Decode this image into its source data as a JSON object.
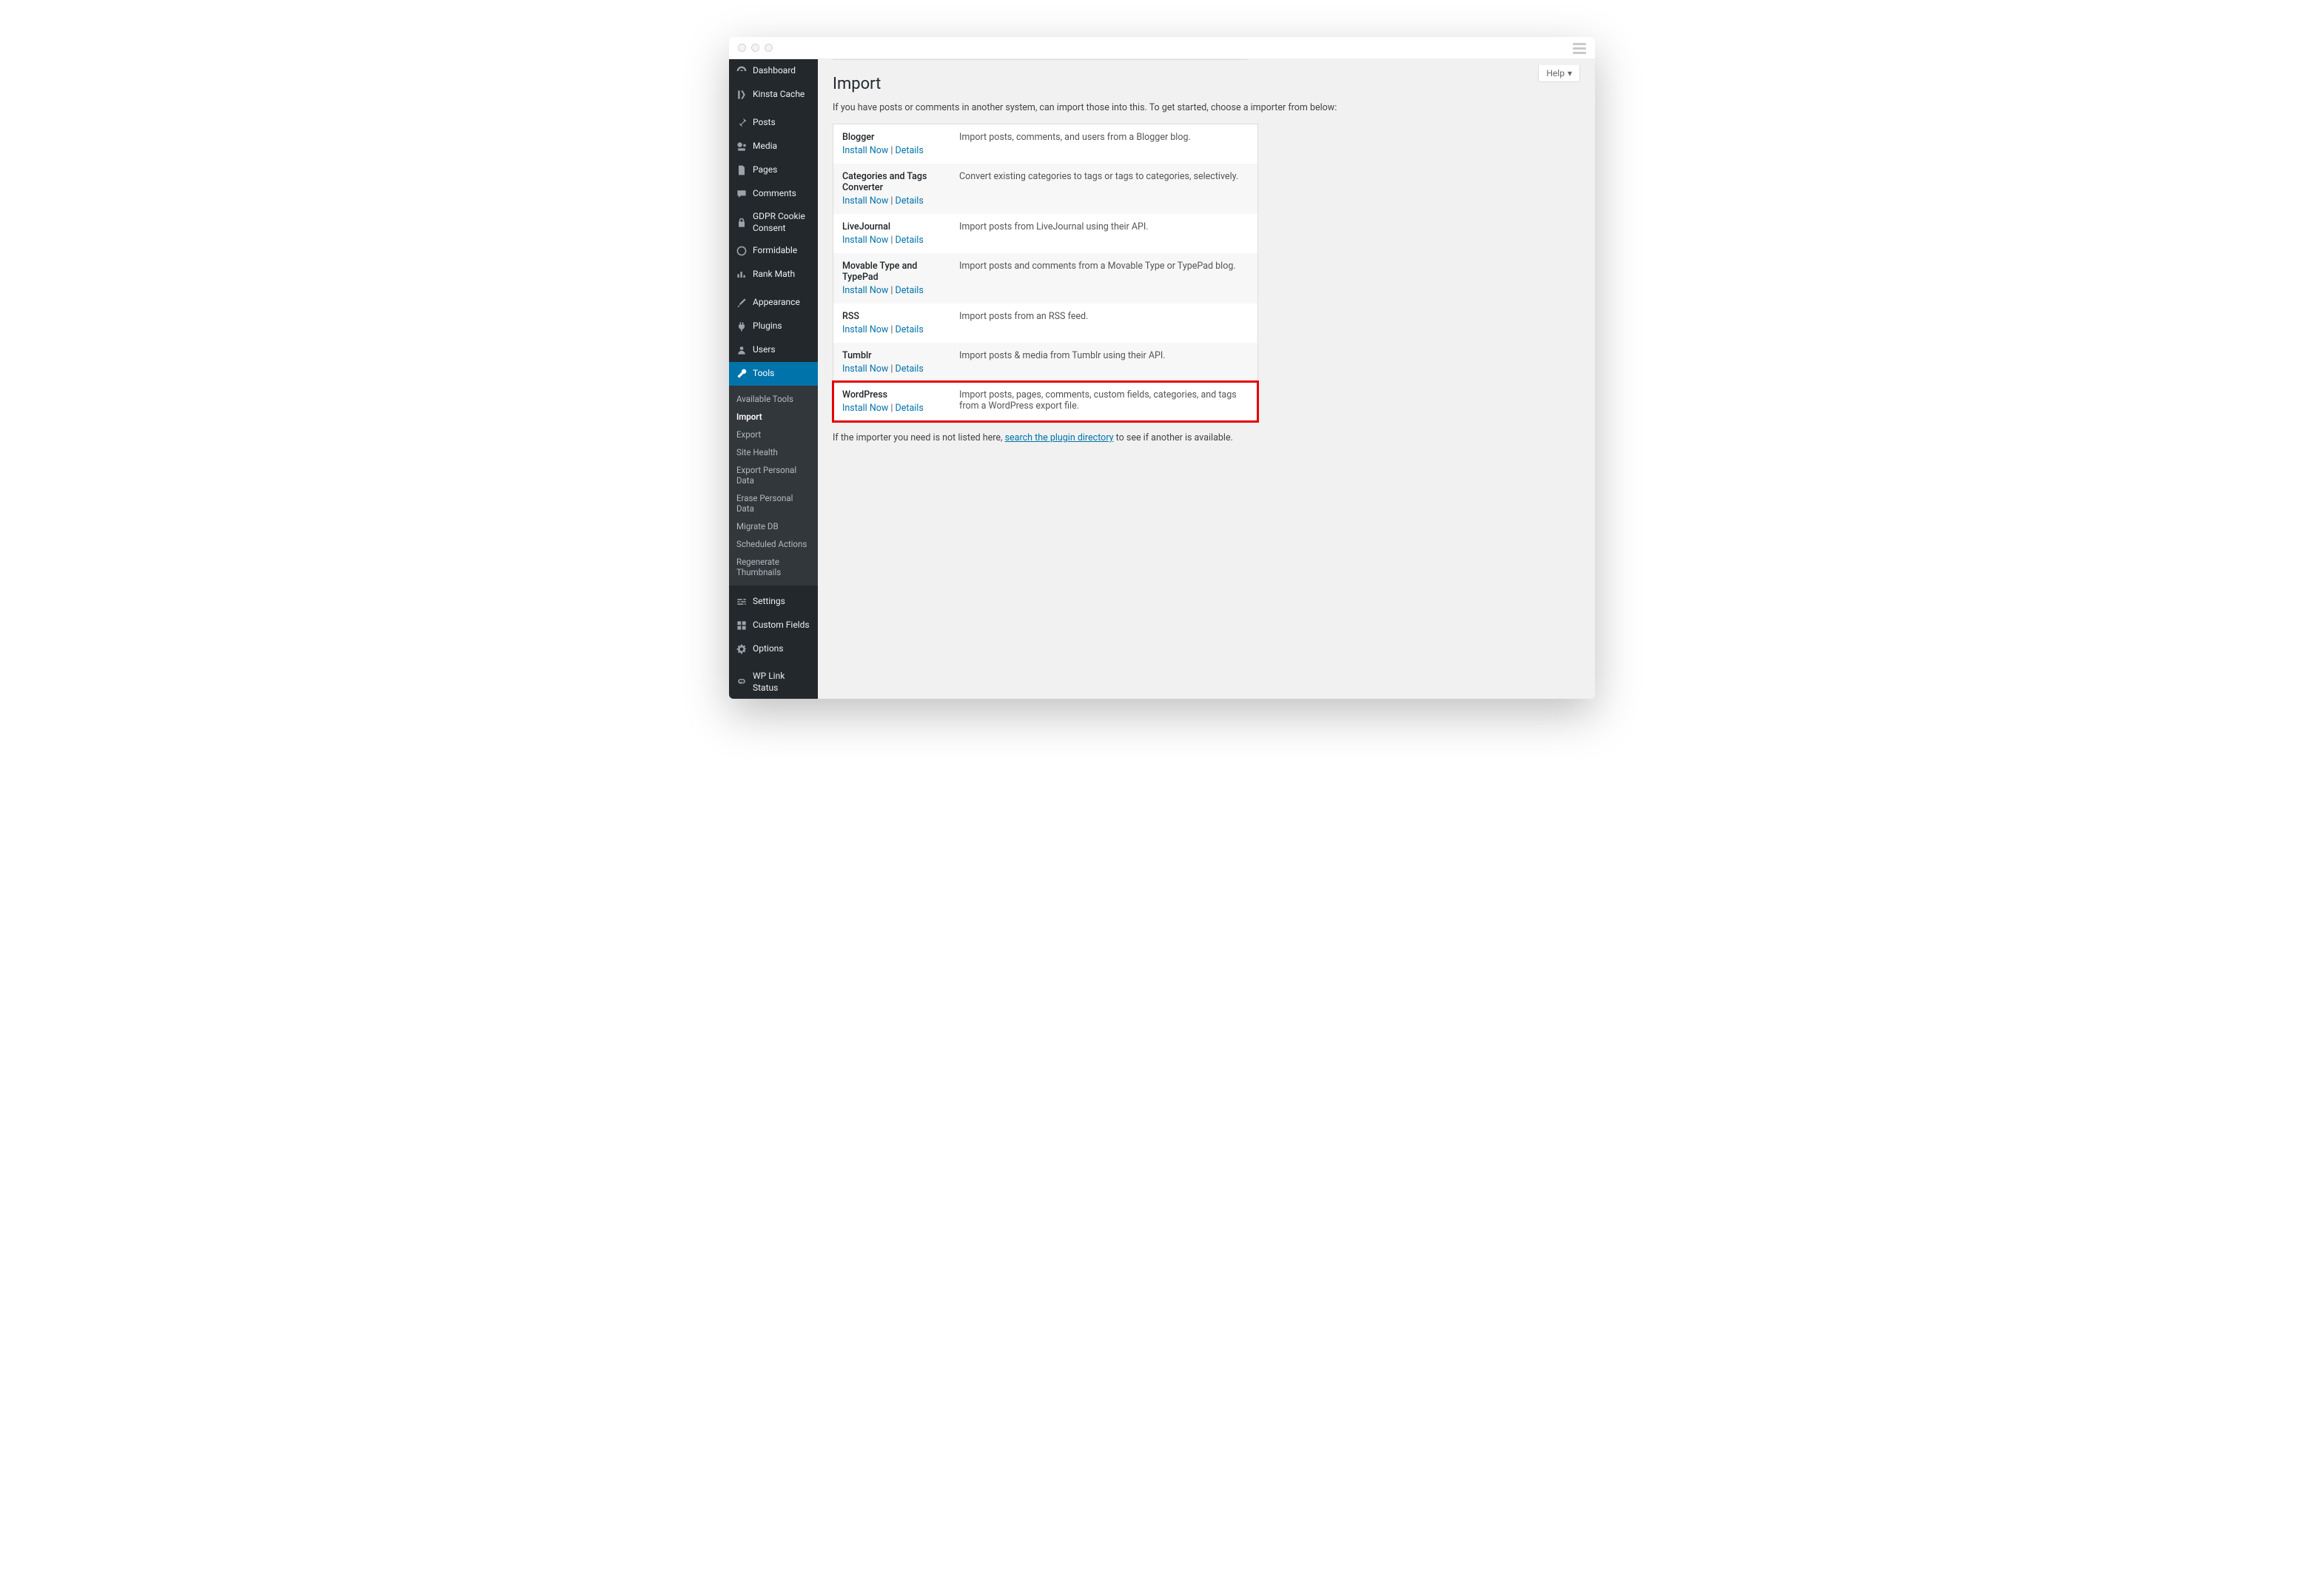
{
  "help_label": "Help",
  "page_title": "Import",
  "intro_text": "If you have posts or comments in another system, can import those into this. To get started, choose a importer from below:",
  "after_text_pre": "If the importer you need is not listed here, ",
  "after_text_link": "search the plugin directory",
  "after_text_post": " to see if another is available.",
  "action_install": "Install Now",
  "action_details": "Details",
  "sidebar": [
    {
      "icon": "dashboard",
      "label": "Dashboard"
    },
    {
      "icon": "kinsta",
      "label": "Kinsta Cache"
    },
    {
      "icon": "pin",
      "label": "Posts",
      "sep": true
    },
    {
      "icon": "media",
      "label": "Media"
    },
    {
      "icon": "page",
      "label": "Pages"
    },
    {
      "icon": "comment",
      "label": "Comments"
    },
    {
      "icon": "lock",
      "label": "GDPR Cookie Consent"
    },
    {
      "icon": "circle",
      "label": "Formidable"
    },
    {
      "icon": "chart",
      "label": "Rank Math"
    },
    {
      "icon": "brush",
      "label": "Appearance",
      "sep": true
    },
    {
      "icon": "plug",
      "label": "Plugins"
    },
    {
      "icon": "user",
      "label": "Users"
    },
    {
      "icon": "wrench",
      "label": "Tools",
      "current": true
    },
    {
      "icon": "sliders",
      "label": "Settings",
      "sep": true
    },
    {
      "icon": "grid",
      "label": "Custom Fields"
    },
    {
      "icon": "gear",
      "label": "Options"
    },
    {
      "icon": "link",
      "label": "WP Link Status",
      "sep": true
    }
  ],
  "submenu": [
    {
      "label": "Available Tools"
    },
    {
      "label": "Import",
      "current": true
    },
    {
      "label": "Export"
    },
    {
      "label": "Site Health"
    },
    {
      "label": "Export Personal Data"
    },
    {
      "label": "Erase Personal Data"
    },
    {
      "label": "Migrate DB"
    },
    {
      "label": "Scheduled Actions"
    },
    {
      "label": "Regenerate Thumbnails"
    }
  ],
  "importers": [
    {
      "name": "Blogger",
      "desc": "Import posts, comments, and users from a Blogger blog."
    },
    {
      "name": "Categories and Tags Converter",
      "desc": "Convert existing categories to tags or tags to categories, selectively."
    },
    {
      "name": "LiveJournal",
      "desc": "Import posts from LiveJournal using their API."
    },
    {
      "name": "Movable Type and TypePad",
      "desc": "Import posts and comments from a Movable Type or TypePad blog."
    },
    {
      "name": "RSS",
      "desc": "Import posts from an RSS feed."
    },
    {
      "name": "Tumblr",
      "desc": "Import posts & media from Tumblr using their API."
    },
    {
      "name": "WordPress",
      "desc": "Import posts, pages, comments, custom fields, categories, and tags from a WordPress export file.",
      "highlight": true
    }
  ]
}
